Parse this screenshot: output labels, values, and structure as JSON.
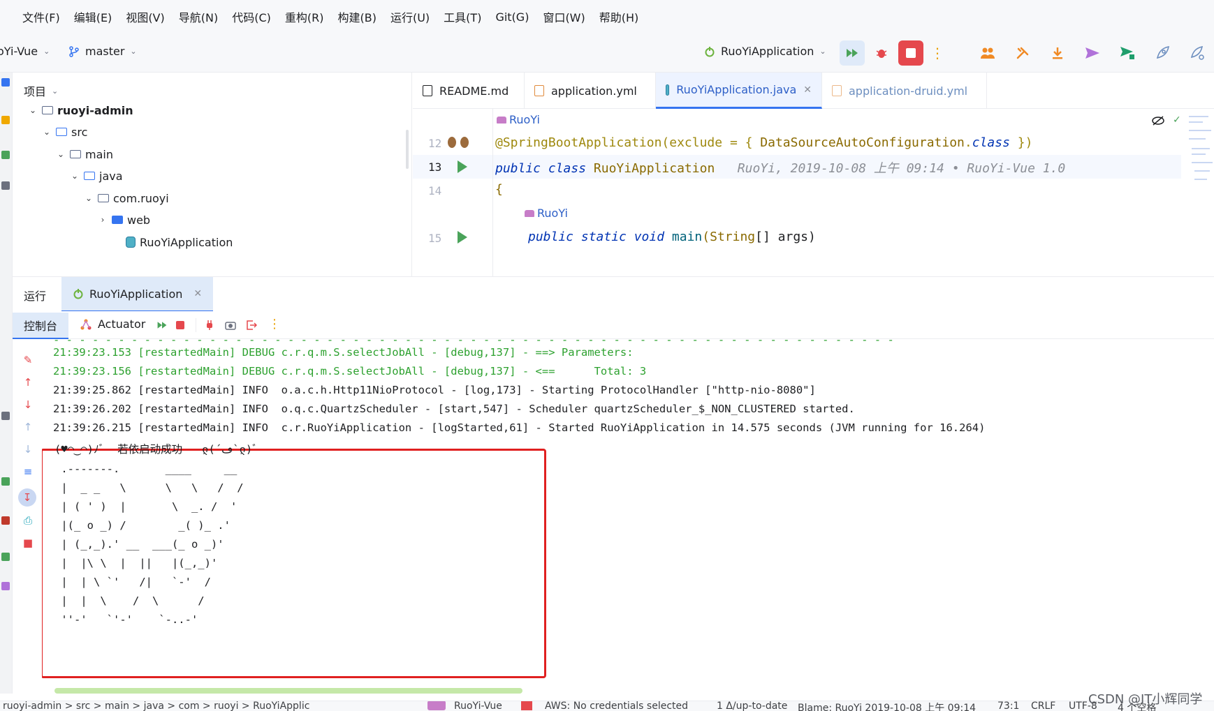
{
  "menubar": {
    "items": [
      "文件(F)",
      "编辑(E)",
      "视图(V)",
      "导航(N)",
      "代码(C)",
      "重构(R)",
      "构建(B)",
      "运行(U)",
      "工具(T)",
      "Git(G)",
      "窗口(W)",
      "帮助(H)"
    ]
  },
  "toolbar": {
    "project_name": "oYi-Vue",
    "branch": "master",
    "run_config": "RuoYiApplication"
  },
  "project_panel": {
    "header": "项目",
    "tree": [
      {
        "label": "ruoyi-admin"
      },
      {
        "label": "src"
      },
      {
        "label": "main"
      },
      {
        "label": "java"
      },
      {
        "label": "com.ruoyi"
      },
      {
        "label": "web"
      },
      {
        "label": "RuoYiApplication"
      }
    ]
  },
  "editor": {
    "tabs": [
      {
        "label": "README.md"
      },
      {
        "label": "application.yml"
      },
      {
        "label": "RuoYiApplication.java"
      },
      {
        "label": "application-druid.yml"
      }
    ],
    "author_label": "RuoYi",
    "lines": [
      {
        "num": "12",
        "text_a": "@SpringBootApplication(",
        "text_b": "exclude",
        "text_c": " = { ",
        "text_d": "DataSourceAutoConfiguration",
        "text_e": ".",
        "text_f": "class",
        "text_g": " })"
      },
      {
        "num": "13",
        "text_a": "public class ",
        "text_b": "RuoYiApplication",
        "hint": "RuoYi, 2019-10-08 上午 09:14 • RuoYi-Vue 1.0"
      },
      {
        "num": "14",
        "text_a": "{"
      },
      {
        "num": "15",
        "text_a": "public static void ",
        "text_b": "main",
        "text_c": "(",
        "text_d": "String",
        "text_e": "[] args)"
      }
    ]
  },
  "run_window": {
    "label": "运行",
    "tab_label": "RuoYiApplication",
    "console_tab": "控制台",
    "actuator_label": "Actuator"
  },
  "console": {
    "cut_line": "- - - - - - - - - - - - - - - - - - - - - - - - - - - - - - - - - - - - - - - - - - - - - - - - - - - - - - - - - - - - - - - - -",
    "lines": [
      {
        "text": "21:39:23.153 [restartedMain] DEBUG c.r.q.m.S.selectJobAll - [debug,137] - ==> Parameters:",
        "color": "#2da12f"
      },
      {
        "text": "21:39:23.156 [restartedMain] DEBUG c.r.q.m.S.selectJobAll - [debug,137] - <==      Total: 3",
        "color": "#2da12f"
      },
      {
        "text": "21:39:25.862 [restartedMain] INFO  o.a.c.h.Http11NioProtocol - [log,173] - Starting ProtocolHandler [\"http-nio-8080\"]",
        "color": "#1e1f22"
      },
      {
        "text": "21:39:26.202 [restartedMain] INFO  o.q.c.QuartzScheduler - [start,547] - Scheduler quartzScheduler_$_NON_CLUSTERED started.",
        "color": "#1e1f22"
      },
      {
        "text": "21:39:26.215 [restartedMain] INFO  c.r.RuoYiApplication - [logStarted,61] - Started RuoYiApplication in 14.575 seconds (JVM running for 16.264)",
        "color": "#1e1f22"
      }
    ],
    "banner": [
      "(♥◠‿◠)ﾉﾞ  若依启动成功   ლ(´ڡ`ლ)ﾞ",
      " .-------.       ____     __",
      " |  _ _   \\      \\   \\   /  /",
      " | ( ' )  |       \\  _. /  '",
      " |(_ o _) /        _( )_ .'",
      " | (_,_).' __  ___(_ o _)'",
      " |  |\\ \\  |  ||   |(_,_)'",
      " |  | \\ `'   /|   `-'  /",
      " |  |  \\    /  \\      /",
      " ''-'   `'-'    `-..-'"
    ]
  },
  "statusbar": {
    "breadcrumb": "ruoyi-admin  >  src  >  main  >  java  >  com  >  ruoyi  >  RuoYiApplic",
    "project": "RuoYi-Vue",
    "aws": "AWS: No credentials selected",
    "git": "1 Δ/up-to-date",
    "blame": "Blame: RuoYi 2019-10-08 上午 09:14",
    "position": "73:1",
    "line_sep": "CRLF",
    "encoding": "UTF-8",
    "indent": "4 个空格"
  },
  "watermark": "CSDN @IT小辉同学",
  "colors": {
    "accent": "#3574f0",
    "console_debug": "#2da12f",
    "banner_border": "#e02020",
    "stop_button": "#e5484d"
  }
}
